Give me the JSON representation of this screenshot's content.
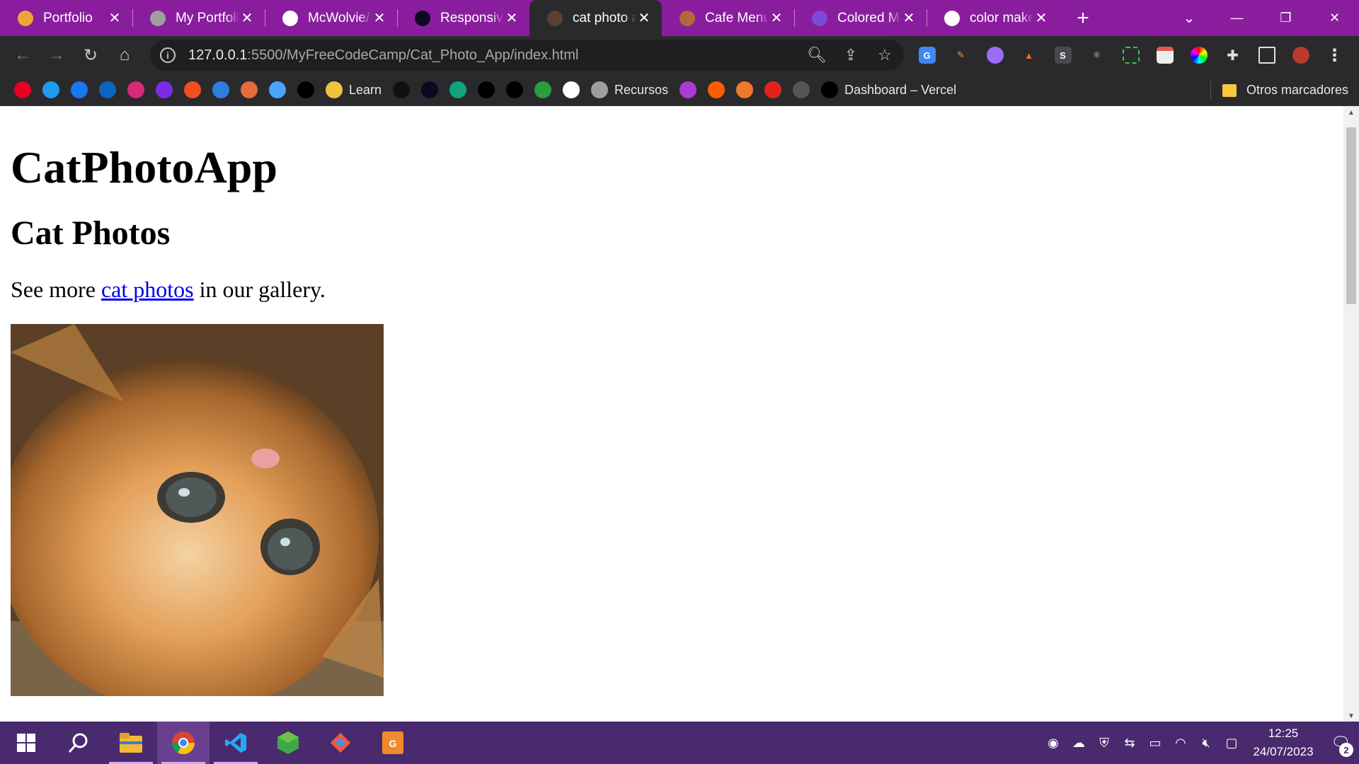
{
  "tabs": [
    {
      "title": "Portfolio",
      "icon": "portfolio-favicon",
      "color": "#f0a33a"
    },
    {
      "title": "My Portfolio",
      "icon": "globe-favicon",
      "color": "#9e9e9e"
    },
    {
      "title": "McWolvie/f",
      "icon": "github-favicon",
      "color": "#ffffff"
    },
    {
      "title": "Responsive",
      "icon": "freecodecamp-favicon",
      "color": "#0a0a23"
    },
    {
      "title": "cat photo a",
      "icon": "cat-favicon",
      "color": "#5a4030",
      "active": true
    },
    {
      "title": "Cafe Menu",
      "icon": "cafe-favicon",
      "color": "#b06a3a"
    },
    {
      "title": "Colored Ma",
      "icon": "colored-markers-favicon",
      "color": "#7a4bd6"
    },
    {
      "title": "color make",
      "icon": "google-favicon",
      "color": "#ffffff"
    }
  ],
  "address_bar": {
    "host": "127.0.0.1",
    "path": ":5500/MyFreeCodeCamp/Cat_Photo_App/index.html"
  },
  "bookmarks": [
    {
      "icon": "pinterest-icon",
      "color": "#e60023",
      "label": ""
    },
    {
      "icon": "twitter-icon",
      "color": "#1d9bf0",
      "label": ""
    },
    {
      "icon": "facebook-icon",
      "color": "#1877f2",
      "label": ""
    },
    {
      "icon": "linkedin-icon",
      "color": "#0a66c2",
      "label": ""
    },
    {
      "icon": "instagram-icon",
      "color": "#d62976",
      "label": ""
    },
    {
      "icon": "canva-icon",
      "color": "#7d2ae8",
      "label": ""
    },
    {
      "icon": "figma-icon",
      "color": "#f24e1e",
      "label": ""
    },
    {
      "icon": "blue-bot-icon",
      "color": "#2f7de1",
      "label": ""
    },
    {
      "icon": "xd-icon",
      "color": "#e46c3c",
      "label": ""
    },
    {
      "icon": "c-circle-icon",
      "color": "#4aa3ff",
      "label": ""
    },
    {
      "icon": "unsplash-icon",
      "color": "#000000",
      "label": ""
    },
    {
      "icon": "js-icon",
      "color": "#f0c33c",
      "label": "Learn"
    },
    {
      "icon": "github-icon",
      "color": "#111111",
      "label": ""
    },
    {
      "icon": "freecodecamp-icon",
      "color": "#0a0a23",
      "label": ""
    },
    {
      "icon": "chatgpt-icon",
      "color": "#10a37f",
      "label": ""
    },
    {
      "icon": "midudev-icon",
      "color": "#000000",
      "label": ""
    },
    {
      "icon": "codepen-icon",
      "color": "#000000",
      "label": ""
    },
    {
      "icon": "w-green-icon",
      "color": "#2a9d3f",
      "label": ""
    },
    {
      "icon": "w3schools-icon",
      "color": "#ffffff",
      "label": ""
    },
    {
      "icon": "tools-icon",
      "color": "#9e9e9e",
      "label": "Recursos"
    },
    {
      "icon": "game-icon",
      "color": "#b03ad6",
      "label": ""
    },
    {
      "icon": "astro-icon",
      "color": "#ff5d01",
      "label": ""
    },
    {
      "icon": "orange-icon",
      "color": "#f07a2a",
      "label": ""
    },
    {
      "icon": "m-red-icon",
      "color": "#e2231a",
      "label": ""
    },
    {
      "icon": "eye-icon",
      "color": "#555555",
      "label": ""
    },
    {
      "icon": "vercel-icon",
      "color": "#000000",
      "label": "Dashboard – Vercel"
    }
  ],
  "other_bookmarks": "Otros marcadores",
  "page": {
    "heading": "CatPhotoApp",
    "subheading": "Cat Photos",
    "text_before": "See more ",
    "link_text": "cat photos",
    "text_after": " in our gallery."
  },
  "taskbar": {
    "time": "12:25",
    "date": "24/07/2023",
    "notifications": "2"
  }
}
